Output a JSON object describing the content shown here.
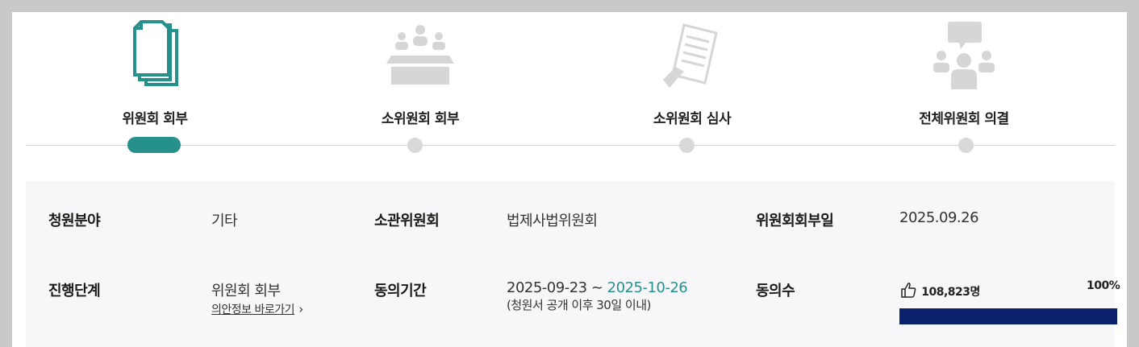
{
  "steps": [
    {
      "label": "위원회 회부",
      "icon": "documents-icon",
      "active": true
    },
    {
      "label": "소위원회 회부",
      "icon": "meeting-table-icon",
      "active": false
    },
    {
      "label": "소위원회 심사",
      "icon": "document-review-icon",
      "active": false
    },
    {
      "label": "전체위원회 의결",
      "icon": "discussion-group-icon",
      "active": false
    }
  ],
  "colors": {
    "accent": "#25908c",
    "inactive": "#d9d9d9",
    "progress": "#0b216b"
  },
  "info": {
    "field_label": "청원분야",
    "field_value": "기타",
    "committee_label": "소관위원회",
    "committee_value": "법제사법위원회",
    "referral_date_label": "위원회회부일",
    "referral_date_value": "2025.09.26",
    "stage_label": "진행단계",
    "stage_value": "위원회 회부",
    "bill_link": "의안정보 바로가기",
    "bill_link_arrow": "›",
    "period_label": "동의기간",
    "period_start": "2025-09-23 ~ ",
    "period_end": "2025-10-26",
    "period_note": "(청원서 공개 이후 30일 이내)",
    "agree_label": "동의수",
    "agree_count": "108,823명",
    "agree_percent": "100%",
    "agree_progress": 1.0
  }
}
